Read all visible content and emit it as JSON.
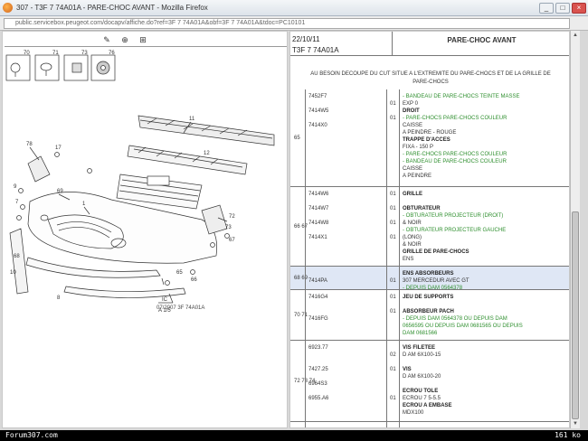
{
  "window": {
    "title": "307 - T3F 7 74A01A - PARE-CHOC AVANT - Mozilla Firefox",
    "minimize": "_",
    "maximize": "□",
    "close": "×"
  },
  "address": {
    "url": "public.servicebox.peugeot.com/docapv/affiche.do?ref=3F 7 74A01A&obf=3F 7 74A01A&tdoc=PC10101"
  },
  "toolbar": {
    "icons": [
      "print-icon",
      "zoom-in-icon",
      "zoom-fit-icon"
    ],
    "glyphs": [
      "✎",
      "⊕",
      "⊞"
    ]
  },
  "drawing": {
    "callouts": [
      "70",
      "71",
      "73",
      "76",
      "1",
      "11",
      "12",
      "9",
      "7",
      "68",
      "67",
      "10",
      "66",
      "65",
      "69",
      "8",
      "72",
      "78",
      "17",
      "8",
      "6"
    ],
    "detail_labels": [
      "70",
      "71",
      "73",
      "76"
    ],
    "small_note": "IC",
    "small_note2": "A 1/5",
    "doc_ref": "07/2007 3F 74A01A"
  },
  "header": {
    "date": "22/10/11",
    "code": "T3F 7 74A01A",
    "section": "PARE-CHOC AVANT"
  },
  "notice": "AU BESOIN DECOUPE DU CUT SITUE A L'EXTREMITE DU PARE-CHOCS ET DE LA GRILLE DE PARE-CHOCS",
  "rows": [
    {
      "grp": "",
      "refs": [
        "7452F7",
        "",
        "7414W5",
        "",
        "7414X0"
      ],
      "qtys": [
        "",
        "01",
        "",
        "01",
        ""
      ],
      "lines": [
        {
          "t": "- BANDEAU DE PARE-CHOCS TEINTE MASSE",
          "s": "green"
        },
        {
          "t": "EXP 0",
          "s": ""
        },
        {
          "t": "DROIT",
          "s": "bold"
        },
        {
          "t": "- PARE-CHOCS PARE-CHOCS COULEUR",
          "s": "green"
        },
        {
          "t": "CAISSE",
          "s": ""
        },
        {
          "t": "A PEINDRE - ROUGE",
          "s": ""
        },
        {
          "t": "TRAPPE D'ACCES",
          "s": "bold"
        },
        {
          "t": "FIXA - 150 P",
          "s": ""
        },
        {
          "t": "- PARE-CHOCS PARE-CHOCS COULEUR",
          "s": "green"
        },
        {
          "t": "- BANDEAU DE PARE-CHOCS COULEUR",
          "s": "green"
        },
        {
          "t": "CAISSE",
          "s": ""
        },
        {
          "t": "A PEINDRE",
          "s": ""
        }
      ],
      "grpno": "65",
      "height": 108
    },
    {
      "grp": "",
      "refs": [
        "7414W6",
        "",
        "7414W7",
        "",
        "7414W8",
        "",
        "7414X1"
      ],
      "qtys": [
        "01",
        "",
        "01",
        "",
        "01",
        "",
        "01"
      ],
      "lines": [
        {
          "t": "GRILLE",
          "s": "bold"
        },
        {
          "t": "",
          "s": ""
        },
        {
          "t": "OBTURATEUR",
          "s": "bold"
        },
        {
          "t": "- OBTURATEUR PROJECTEUR (DROIT)",
          "s": "green"
        },
        {
          "t": "& NOIR",
          "s": ""
        },
        {
          "t": "- OBTURATEUR PROJECTEUR GAUCHE",
          "s": "green"
        },
        {
          "t": "(LONG)",
          "s": ""
        },
        {
          "t": "& NOIR",
          "s": ""
        },
        {
          "t": "GRILLE DE PARE-CHOCS",
          "s": "bold"
        },
        {
          "t": "ENS",
          "s": ""
        }
      ],
      "grpno": "66 67",
      "height": 88
    },
    {
      "grp": "",
      "refs": [
        "",
        "7414PA"
      ],
      "qtys": [
        "",
        "01"
      ],
      "lines": [
        {
          "t": "ENS ABSORBEURS",
          "s": "bold"
        },
        {
          "t": "307 MERCEDUR AVEC GT",
          "s": ""
        },
        {
          "t": "- DEPUIS DAM 0564378",
          "s": "green"
        }
      ],
      "grpno": "68 69",
      "height": 26,
      "hl": true
    },
    {
      "grp": "",
      "refs": [
        "7416G4",
        "",
        "",
        "7416FG"
      ],
      "qtys": [
        "01",
        "",
        "01",
        ""
      ],
      "lines": [
        {
          "t": "JEU DE SUPPORTS",
          "s": "bold"
        },
        {
          "t": "",
          "s": ""
        },
        {
          "t": "ABSORBEUR PACH",
          "s": "bold"
        },
        {
          "t": "- DEPUIS DAM 0564378 OU DEPUIS DAM",
          "s": "green"
        },
        {
          "t": "0656595 OU DEPUIS DAM 0681565 OU DEPUIS",
          "s": "green"
        },
        {
          "t": "DAM 0681566",
          "s": "green"
        }
      ],
      "grpno": "70 71",
      "height": 56
    },
    {
      "grp": "",
      "refs": [
        "6923.77",
        "",
        "",
        "7427.25",
        "",
        "6964S3",
        "",
        "6955.A6"
      ],
      "qtys": [
        "",
        "02",
        "",
        "01",
        "",
        "",
        "",
        "01"
      ],
      "lines": [
        {
          "t": "VIS FILETEE",
          "s": "bold"
        },
        {
          "t": "D AM 6X100-15",
          "s": ""
        },
        {
          "t": "",
          "s": ""
        },
        {
          "t": "VIS",
          "s": "bold"
        },
        {
          "t": "D AM 6X100-20",
          "s": ""
        },
        {
          "t": "",
          "s": ""
        },
        {
          "t": "ECROU TOLE",
          "s": "bold"
        },
        {
          "t": "ECROU 7 5-5.5",
          "s": ""
        },
        {
          "t": "ECROU A EMBASE",
          "s": "bold"
        },
        {
          "t": "MDX100",
          "s": ""
        }
      ],
      "grpno": "72 73 74",
      "height": 90
    }
  ],
  "statusbar": {
    "left": "Forum307.com",
    "right": "161 ko"
  }
}
